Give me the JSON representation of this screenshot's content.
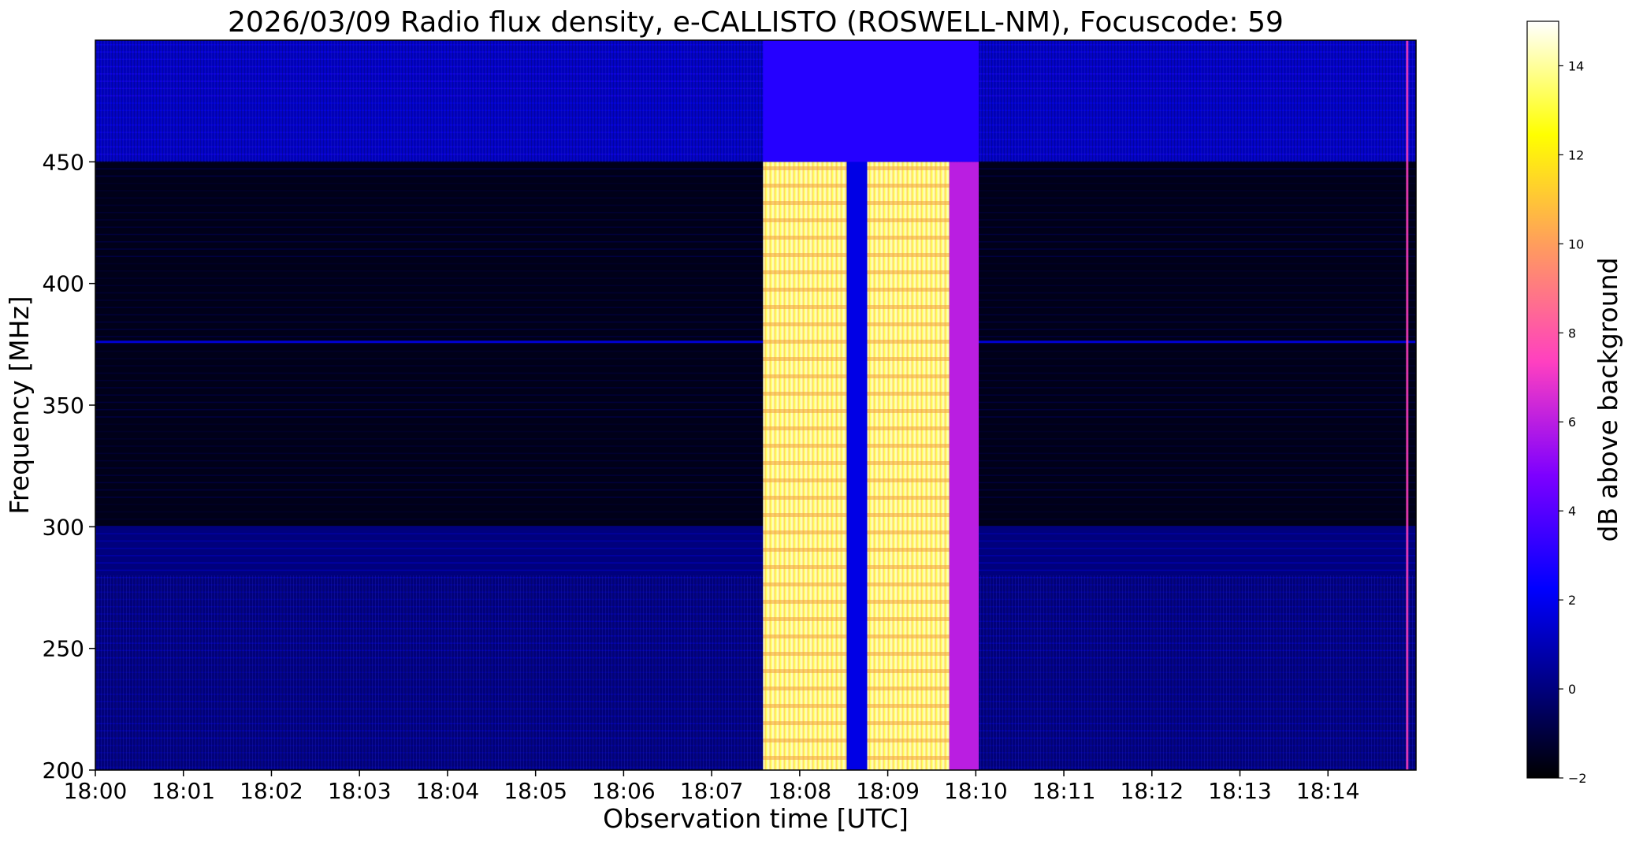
{
  "chart_data": {
    "type": "heatmap",
    "title": "2026/03/09  Radio flux density, e-CALLISTO (ROSWELL-NM), Focuscode: 59",
    "xlabel": "Observation time [UTC]",
    "ylabel": "Frequency [MHz]",
    "colorbar_label": "dB above background",
    "colormap": "gnuplot2",
    "xlim": [
      "18:00:00",
      "18:15:00"
    ],
    "ylim": [
      200,
      500
    ],
    "clim": [
      -2,
      15
    ],
    "x_ticks": [
      "18:00",
      "18:01",
      "18:02",
      "18:03",
      "18:04",
      "18:05",
      "18:06",
      "18:07",
      "18:08",
      "18:09",
      "18:10",
      "18:11",
      "18:12",
      "18:13",
      "18:14"
    ],
    "y_ticks": [
      200,
      250,
      300,
      350,
      400,
      450
    ],
    "colorbar_ticks": [
      -2,
      0,
      2,
      4,
      6,
      8,
      10,
      12,
      14
    ],
    "background_bands": [
      {
        "freq_range": [
          450,
          500
        ],
        "value_db": 1.2
      },
      {
        "freq_range": [
          200,
          300
        ],
        "value_db": 0.0
      },
      {
        "freq_range": [
          300,
          450
        ],
        "value_db": -1.6
      }
    ],
    "burst_columns": [
      {
        "time_range": [
          "18:07:35",
          "18:08:32"
        ],
        "freq_range": [
          200,
          450
        ],
        "value_db": 14.5
      },
      {
        "time_range": [
          "18:08:32",
          "18:08:46"
        ],
        "freq_range": [
          200,
          500
        ],
        "value_db": 1.8
      },
      {
        "time_range": [
          "18:08:46",
          "18:09:42"
        ],
        "freq_range": [
          200,
          450
        ],
        "value_db": 14.5
      },
      {
        "time_range": [
          "18:09:42",
          "18:10:02"
        ],
        "freq_range": [
          200,
          450
        ],
        "value_db": 6.0
      },
      {
        "time_range": [
          "18:07:35",
          "18:10:02"
        ],
        "freq_range": [
          450,
          500
        ],
        "value_db": 3.0
      }
    ],
    "rfi_line_mhz": 376,
    "spike_time": "18:14:54"
  }
}
